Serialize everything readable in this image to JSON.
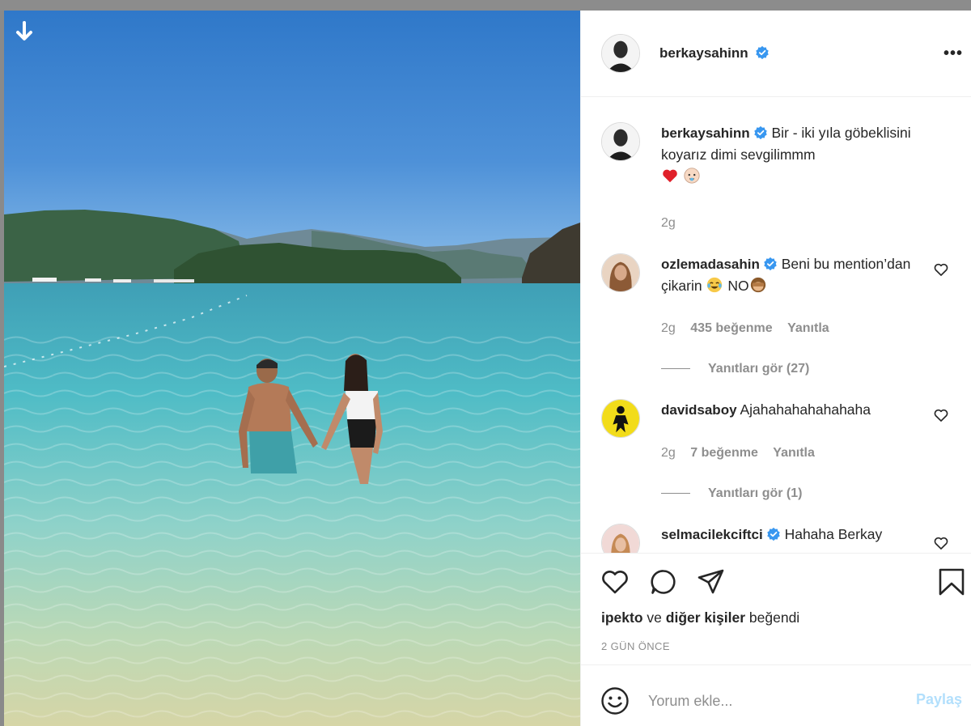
{
  "post": {
    "author": "berkaysahinn",
    "more_label": "•••",
    "caption": {
      "username": "berkaysahinn",
      "text": "Bir - iki yıla göbeklisini koyarız dimi sevgilimmm",
      "emojis": [
        "red-heart",
        "baby-face"
      ],
      "time": "2g"
    }
  },
  "comments": [
    {
      "username": "ozlemadasahin",
      "verified": true,
      "text": "Beni bu mention’dan çikarin",
      "text_suffix": "NO",
      "time": "2g",
      "likes": "435 beğenme",
      "reply_label": "Yanıtla",
      "view_replies": "Yanıtları gör (27)"
    },
    {
      "username": "davidsaboy",
      "verified": false,
      "text": "Ajahahahahahahaha",
      "time": "2g",
      "likes": "7 beğenme",
      "reply_label": "Yanıtla",
      "view_replies": "Yanıtları gör (1)"
    },
    {
      "username": "selmacilekciftci",
      "verified": true,
      "text": "Hahaha Berkay"
    }
  ],
  "likes_line": {
    "user": "ipekto",
    "connector": "ve",
    "others": "diğer kişiler",
    "suffix": "beğendi"
  },
  "timestamp": "2 GÜN ÖNCE",
  "comment_input": {
    "placeholder": "Yorum ekle...",
    "post_label": "Paylaş"
  },
  "colors": {
    "verified_blue": "#3897f0",
    "post_button_disabled": "#b2dffc",
    "secondary_text": "#8e8e8e"
  }
}
